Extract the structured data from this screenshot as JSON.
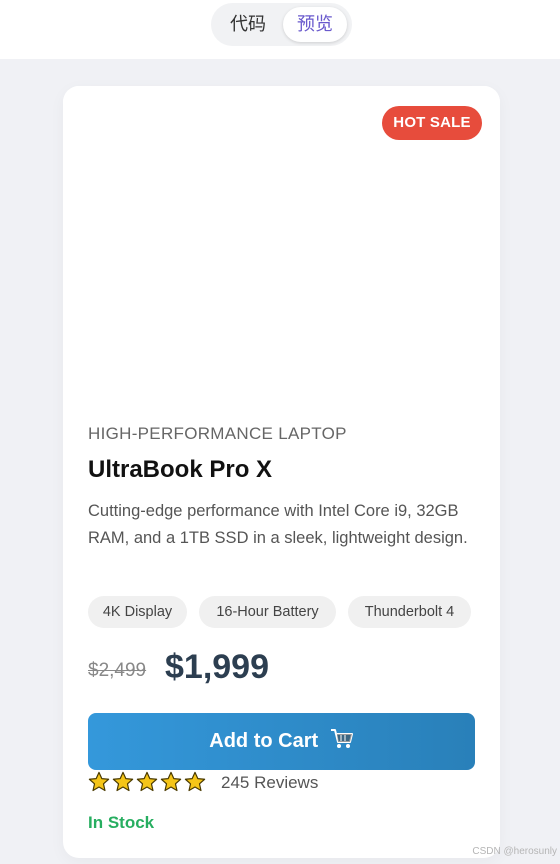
{
  "toggle": {
    "code_label": "代码",
    "preview_label": "预览"
  },
  "product": {
    "badge": "HOT SALE",
    "category": "HIGH-PERFORMANCE LAPTOP",
    "title": "UltraBook Pro X",
    "description": "Cutting-edge performance with Intel Core i9, 32GB RAM, and a 1TB SSD in a sleek, lightweight design.",
    "tags": [
      "4K Display",
      "16-Hour Battery",
      "Thunderbolt 4"
    ],
    "old_price": "$2,499",
    "price": "$1,999",
    "cart_label": "Add to Cart",
    "cart_icon": "shopping-cart-icon",
    "rating": 5,
    "reviews": "245 Reviews",
    "stock": "In Stock"
  },
  "watermark": "CSDN @herosunly",
  "colors": {
    "badge": "#e74c3c",
    "button_start": "#3498db",
    "button_end": "#2980b9",
    "stock": "#27ae60",
    "price": "#2c3e50",
    "star": "#f5c518",
    "toggle_active": "#6a5acd"
  }
}
